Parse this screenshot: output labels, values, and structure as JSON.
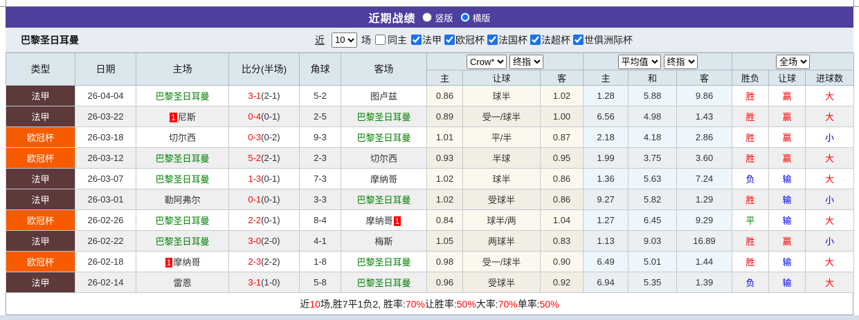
{
  "header": {
    "title": "近期战绩",
    "radio_vertical": "竖版",
    "radio_horizontal": "横版",
    "bar_color": "#4e3e9e"
  },
  "toolbar": {
    "team": "巴黎圣日耳曼",
    "recent_label": "近",
    "recent_value": "10",
    "matches_label": "场",
    "same_home_label": "同主",
    "league_filters": [
      "法甲",
      "欧冠杯",
      "法国杯",
      "法超杯",
      "世俱洲际杯"
    ]
  },
  "table": {
    "selects": {
      "odds_company": "Crow*",
      "odds_stage_left": "终指",
      "avg_mode": "平均值",
      "odds_stage_right": "终指",
      "scope": "全场"
    },
    "main_headers": [
      "类型",
      "日期",
      "主场",
      "比分(半场)",
      "角球",
      "客场"
    ],
    "sub_headers": [
      "主",
      "让球",
      "客",
      "主",
      "和",
      "客",
      "胜负",
      "让球",
      "进球数"
    ],
    "league_colors": {
      "法甲": "#5d393a",
      "欧冠杯": "#f75b00"
    },
    "result_colors": {
      "win": "#ff0000",
      "lose": "#0000ee",
      "draw": "#008000"
    },
    "team_color": "#008000",
    "score_color": "#ff0000",
    "rows": [
      {
        "league": "法甲",
        "date": "26-04-04",
        "home": {
          "name": "巴黎圣日耳曼",
          "team": true
        },
        "score": "3-1",
        "half": "(2-1)",
        "corner": "5-2",
        "away": {
          "name": "图卢兹",
          "team": false
        },
        "odds": [
          "0.86",
          "球半",
          "1.02"
        ],
        "avg": [
          "1.28",
          "5.88",
          "9.86"
        ],
        "results": [
          [
            "胜",
            "win"
          ],
          [
            "赢",
            "win"
          ],
          [
            "大",
            "win"
          ]
        ]
      },
      {
        "league": "法甲",
        "date": "26-03-22",
        "home": {
          "name": "尼斯",
          "team": false,
          "badge": "1",
          "badge_pos": "before"
        },
        "score": "0-4",
        "half": "(0-1)",
        "corner": "2-5",
        "away": {
          "name": "巴黎圣日耳曼",
          "team": true
        },
        "odds": [
          "0.89",
          "受一/球半",
          "1.00"
        ],
        "avg": [
          "6.56",
          "4.98",
          "1.43"
        ],
        "results": [
          [
            "胜",
            "win"
          ],
          [
            "赢",
            "win"
          ],
          [
            "大",
            "win"
          ]
        ]
      },
      {
        "league": "欧冠杯",
        "date": "26-03-18",
        "home": {
          "name": "切尔西",
          "team": false
        },
        "score": "0-3",
        "half": "(0-2)",
        "corner": "9-3",
        "away": {
          "name": "巴黎圣日耳曼",
          "team": true
        },
        "odds": [
          "1.01",
          "平/半",
          "0.87"
        ],
        "avg": [
          "2.18",
          "4.18",
          "2.86"
        ],
        "results": [
          [
            "胜",
            "win"
          ],
          [
            "赢",
            "win"
          ],
          [
            "小",
            "lose"
          ]
        ]
      },
      {
        "league": "欧冠杯",
        "date": "26-03-12",
        "home": {
          "name": "巴黎圣日耳曼",
          "team": true
        },
        "score": "5-2",
        "half": "(2-1)",
        "corner": "2-3",
        "away": {
          "name": "切尔西",
          "team": false
        },
        "odds": [
          "0.93",
          "半球",
          "0.95"
        ],
        "avg": [
          "1.99",
          "3.75",
          "3.60"
        ],
        "results": [
          [
            "胜",
            "win"
          ],
          [
            "赢",
            "win"
          ],
          [
            "大",
            "win"
          ]
        ]
      },
      {
        "league": "法甲",
        "date": "26-03-07",
        "home": {
          "name": "巴黎圣日耳曼",
          "team": true
        },
        "score": "1-3",
        "half": "(0-1)",
        "corner": "7-3",
        "away": {
          "name": "摩纳哥",
          "team": false
        },
        "odds": [
          "1.02",
          "球半",
          "0.86"
        ],
        "avg": [
          "1.36",
          "5.63",
          "7.24"
        ],
        "results": [
          [
            "负",
            "lose"
          ],
          [
            "输",
            "lose"
          ],
          [
            "大",
            "win"
          ]
        ]
      },
      {
        "league": "法甲",
        "date": "26-03-01",
        "home": {
          "name": "勒阿弗尔",
          "team": false
        },
        "score": "0-1",
        "half": "(0-1)",
        "corner": "3-3",
        "away": {
          "name": "巴黎圣日耳曼",
          "team": true
        },
        "odds": [
          "1.02",
          "受球半",
          "0.86"
        ],
        "avg": [
          "9.27",
          "5.82",
          "1.29"
        ],
        "results": [
          [
            "胜",
            "win"
          ],
          [
            "输",
            "lose"
          ],
          [
            "小",
            "lose"
          ]
        ]
      },
      {
        "league": "欧冠杯",
        "date": "26-02-26",
        "home": {
          "name": "巴黎圣日耳曼",
          "team": true
        },
        "score": "2-2",
        "half": "(0-1)",
        "corner": "8-4",
        "away": {
          "name": "摩纳哥",
          "team": false,
          "badge": "1",
          "badge_pos": "after"
        },
        "odds": [
          "0.84",
          "球半/两",
          "1.04"
        ],
        "avg": [
          "1.27",
          "6.45",
          "9.29"
        ],
        "results": [
          [
            "平",
            "draw"
          ],
          [
            "输",
            "lose"
          ],
          [
            "大",
            "win"
          ]
        ]
      },
      {
        "league": "法甲",
        "date": "26-02-22",
        "home": {
          "name": "巴黎圣日耳曼",
          "team": true
        },
        "score": "3-0",
        "half": "(2-0)",
        "corner": "4-1",
        "away": {
          "name": "梅斯",
          "team": false
        },
        "odds": [
          "1.05",
          "两球半",
          "0.83"
        ],
        "avg": [
          "1.13",
          "9.03",
          "16.89"
        ],
        "results": [
          [
            "胜",
            "win"
          ],
          [
            "赢",
            "win"
          ],
          [
            "小",
            "lose"
          ]
        ]
      },
      {
        "league": "欧冠杯",
        "date": "26-02-18",
        "home": {
          "name": "摩纳哥",
          "team": false,
          "badge": "1",
          "badge_pos": "before"
        },
        "score": "2-3",
        "half": "(2-2)",
        "corner": "1-8",
        "away": {
          "name": "巴黎圣日耳曼",
          "team": true
        },
        "odds": [
          "0.98",
          "受一/球半",
          "0.90"
        ],
        "avg": [
          "6.49",
          "5.01",
          "1.44"
        ],
        "results": [
          [
            "胜",
            "win"
          ],
          [
            "输",
            "lose"
          ],
          [
            "大",
            "win"
          ]
        ]
      },
      {
        "league": "法甲",
        "date": "26-02-14",
        "home": {
          "name": "雷恩",
          "team": false
        },
        "score": "3-1",
        "half": "(1-0)",
        "corner": "5-8",
        "away": {
          "name": "巴黎圣日耳曼",
          "team": true
        },
        "odds": [
          "0.96",
          "受球半",
          "0.92"
        ],
        "avg": [
          "6.94",
          "5.35",
          "1.39"
        ],
        "results": [
          [
            "负",
            "lose"
          ],
          [
            "输",
            "lose"
          ],
          [
            "大",
            "win"
          ]
        ]
      }
    ]
  },
  "summary": {
    "segments": [
      [
        "近",
        "black"
      ],
      [
        "10",
        "red"
      ],
      [
        "场,胜7平1负2, 胜率:",
        "black"
      ],
      [
        "70%",
        "red"
      ],
      [
        " 让胜率:",
        "black"
      ],
      [
        "50%",
        "red"
      ],
      [
        " 大率:",
        "black"
      ],
      [
        "70%",
        "red"
      ],
      [
        " 单率:",
        "black"
      ],
      [
        "50%",
        "red"
      ]
    ]
  }
}
